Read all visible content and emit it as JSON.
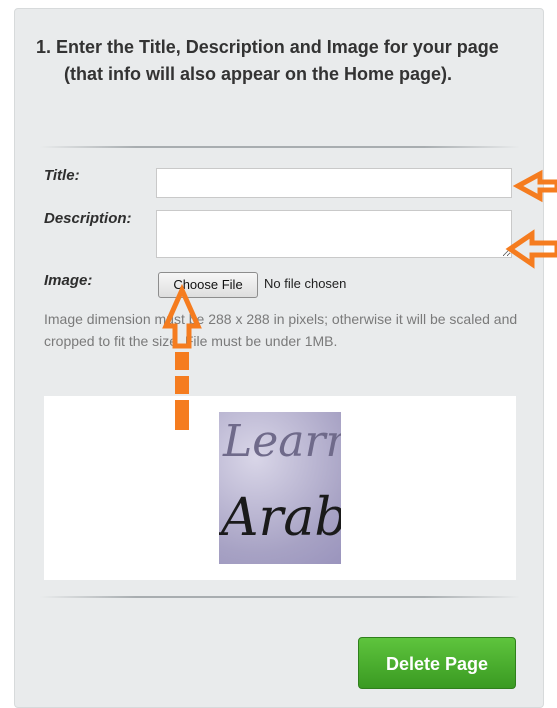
{
  "form": {
    "step_title": "1. Enter the Title, Description and Image for your page (that info will also appear on the Home page).",
    "title_label": "Title:",
    "title_value": "",
    "description_label": "Description:",
    "description_value": "",
    "image_label": "Image:",
    "choose_file_label": "Choose File",
    "no_file_text": "No file chosen",
    "image_note": "Image dimension must be 288 x 288 in pixels; otherwise it will be scaled and cropped to fit the size. File must be under 1MB.",
    "preview_text_line1": "Learn",
    "preview_text_line2": "Arabic",
    "delete_button_label": "Delete Page"
  },
  "colors": {
    "panel_bg": "#e9ebec",
    "accent_green": "#3fa527",
    "annotation_orange": "#f57c1f"
  },
  "annotations": [
    "arrow-left-icon",
    "arrow-left-icon",
    "arrow-up-icon"
  ]
}
